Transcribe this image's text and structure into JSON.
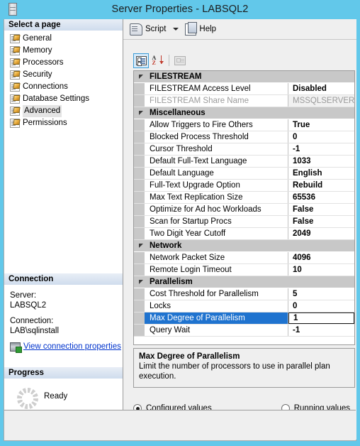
{
  "window": {
    "title": "Server Properties - LABSQL2",
    "icon": "server-icon"
  },
  "sidebar": {
    "header": "Select a page",
    "items": [
      {
        "label": "General",
        "selected": false
      },
      {
        "label": "Memory",
        "selected": false
      },
      {
        "label": "Processors",
        "selected": false
      },
      {
        "label": "Security",
        "selected": false
      },
      {
        "label": "Connections",
        "selected": false
      },
      {
        "label": "Database Settings",
        "selected": false
      },
      {
        "label": "Advanced",
        "selected": true
      },
      {
        "label": "Permissions",
        "selected": false
      }
    ],
    "connection": {
      "header": "Connection",
      "server_label": "Server:",
      "server_value": "LABSQL2",
      "connection_label": "Connection:",
      "connection_value": "LAB\\sqlinstall",
      "link_label": "View connection properties"
    },
    "progress": {
      "header": "Progress",
      "status": "Ready"
    }
  },
  "toolbar": {
    "script_label": "Script",
    "help_label": "Help"
  },
  "grid_toolbar": {
    "categorized_tip": "Categorized",
    "alphabetical_tip": "Alphabetical",
    "pages_tip": "Property Pages"
  },
  "grid": {
    "categories": [
      {
        "name": "FILESTREAM",
        "rows": [
          {
            "name": "FILESTREAM Access Level",
            "value": "Disabled",
            "state": "normal"
          },
          {
            "name": "FILESTREAM Share Name",
            "value": "MSSQLSERVER",
            "state": "disabled"
          }
        ]
      },
      {
        "name": "Miscellaneous",
        "rows": [
          {
            "name": "Allow Triggers to Fire Others",
            "value": "True",
            "state": "normal"
          },
          {
            "name": "Blocked Process Threshold",
            "value": "0",
            "state": "normal"
          },
          {
            "name": "Cursor Threshold",
            "value": "-1",
            "state": "normal"
          },
          {
            "name": "Default Full-Text Language",
            "value": "1033",
            "state": "normal"
          },
          {
            "name": "Default Language",
            "value": "English",
            "state": "normal"
          },
          {
            "name": "Full-Text Upgrade Option",
            "value": "Rebuild",
            "state": "normal"
          },
          {
            "name": "Max Text Replication Size",
            "value": "65536",
            "state": "normal"
          },
          {
            "name": "Optimize for Ad hoc Workloads",
            "value": "False",
            "state": "normal"
          },
          {
            "name": "Scan for Startup Procs",
            "value": "False",
            "state": "normal"
          },
          {
            "name": "Two Digit Year Cutoff",
            "value": "2049",
            "state": "normal"
          }
        ]
      },
      {
        "name": "Network",
        "rows": [
          {
            "name": "Network Packet Size",
            "value": "4096",
            "state": "normal"
          },
          {
            "name": "Remote Login Timeout",
            "value": "10",
            "state": "normal"
          }
        ]
      },
      {
        "name": "Parallelism",
        "rows": [
          {
            "name": "Cost Threshold for Parallelism",
            "value": "5",
            "state": "normal"
          },
          {
            "name": "Locks",
            "value": "0",
            "state": "normal"
          },
          {
            "name": "Max Degree of Parallelism",
            "value": "1",
            "state": "selected"
          },
          {
            "name": "Query Wait",
            "value": "-1",
            "state": "normal"
          }
        ]
      }
    ]
  },
  "description": {
    "title": "Max Degree of Parallelism",
    "text": "Limit the number of processors to use in parallel plan execution."
  },
  "value_mode": {
    "configured_label": "Configured values",
    "configured_selected": true,
    "running_label": "Running values",
    "running_selected": false
  },
  "colors": {
    "titlebar": "#62c8ea",
    "selection": "#1f73cf",
    "category": "#c8c8c8",
    "link": "#0033cc"
  }
}
